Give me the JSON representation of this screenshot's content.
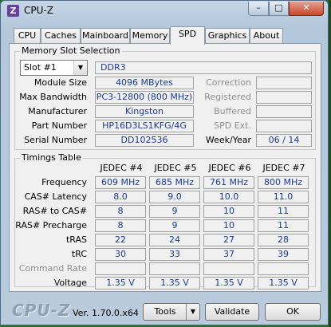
{
  "window": {
    "title": "CPU-Z",
    "app_icon": "Z"
  },
  "titlebar": {
    "min": "–",
    "max": "□",
    "close": "✕"
  },
  "tabs": [
    "CPU",
    "Caches",
    "Mainboard",
    "Memory",
    "SPD",
    "Graphics",
    "About"
  ],
  "active_tab": "SPD",
  "memory_slot": {
    "group_title": "Memory Slot Selection",
    "slot_value": "Slot #1",
    "type": "DDR3",
    "rows": [
      {
        "label": "Module Size",
        "value": "4096 MBytes"
      },
      {
        "label": "Max Bandwidth",
        "value": "PC3-12800 (800 MHz)"
      },
      {
        "label": "Manufacturer",
        "value": "Kingston"
      },
      {
        "label": "Part Number",
        "value": "HP16D3LS1KFG/4G"
      },
      {
        "label": "Serial Number",
        "value": "DD102536"
      }
    ],
    "right_labels": [
      "Correction",
      "Registered",
      "Buffered",
      "SPD Ext.",
      "Week/Year"
    ],
    "week_year": "06 / 14"
  },
  "timings": {
    "group_title": "Timings Table",
    "columns": [
      "JEDEC #4",
      "JEDEC #5",
      "JEDEC #6",
      "JEDEC #7"
    ],
    "rows": [
      {
        "label": "Frequency",
        "values": [
          "609 MHz",
          "685 MHz",
          "761 MHz",
          "800 MHz"
        ]
      },
      {
        "label": "CAS# Latency",
        "values": [
          "8.0",
          "9.0",
          "10.0",
          "11.0"
        ]
      },
      {
        "label": "RAS# to CAS#",
        "values": [
          "8",
          "9",
          "10",
          "11"
        ]
      },
      {
        "label": "RAS# Precharge",
        "values": [
          "8",
          "9",
          "10",
          "11"
        ]
      },
      {
        "label": "tRAS",
        "values": [
          "22",
          "24",
          "27",
          "28"
        ]
      },
      {
        "label": "tRC",
        "values": [
          "30",
          "33",
          "37",
          "39"
        ]
      },
      {
        "label": "Command Rate",
        "values": [
          "",
          "",
          "",
          ""
        ]
      },
      {
        "label": "Voltage",
        "values": [
          "1.35 V",
          "1.35 V",
          "1.35 V",
          "1.35 V"
        ]
      }
    ]
  },
  "footer": {
    "brand": "CPU-Z",
    "version": "Ver. 1.70.0.x64",
    "tools_label": "Tools",
    "validate_label": "Validate",
    "ok_label": "OK"
  }
}
